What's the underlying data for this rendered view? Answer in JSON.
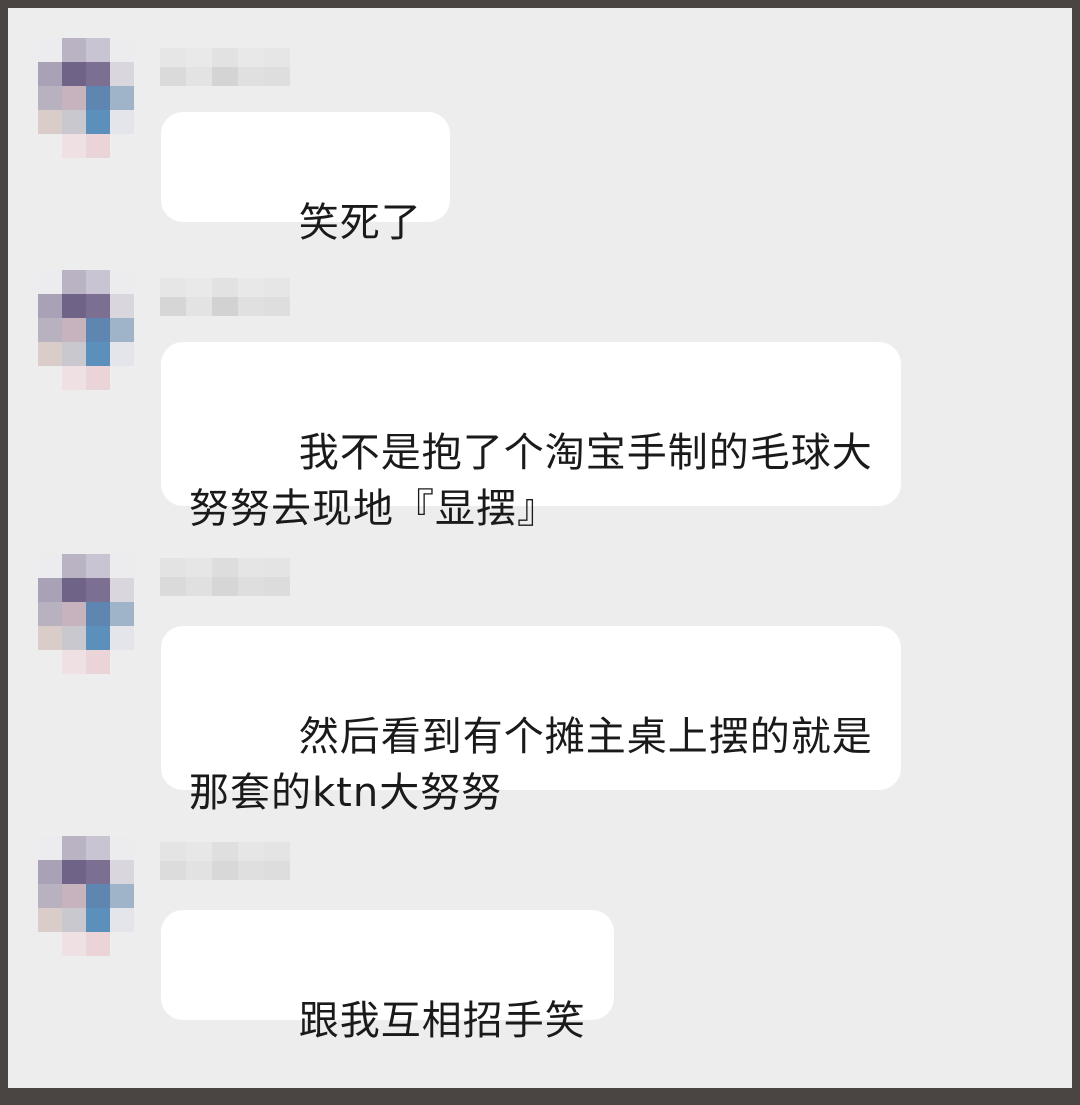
{
  "chat": {
    "messages": [
      {
        "sender": "",
        "text": "笑死了"
      },
      {
        "sender": "",
        "text": "我不是抱了个淘宝手制的毛球大\n努努去现地『显摆』"
      },
      {
        "sender": "",
        "text": "然后看到有个摊主桌上摆的就是\n那套的ktn大努努"
      },
      {
        "sender": "",
        "text": "跟我互相招手笑"
      }
    ]
  },
  "colors": {
    "background": "#ededed",
    "bubble": "#ffffff",
    "frame": "#4a4442",
    "text": "#1a1a1a"
  }
}
